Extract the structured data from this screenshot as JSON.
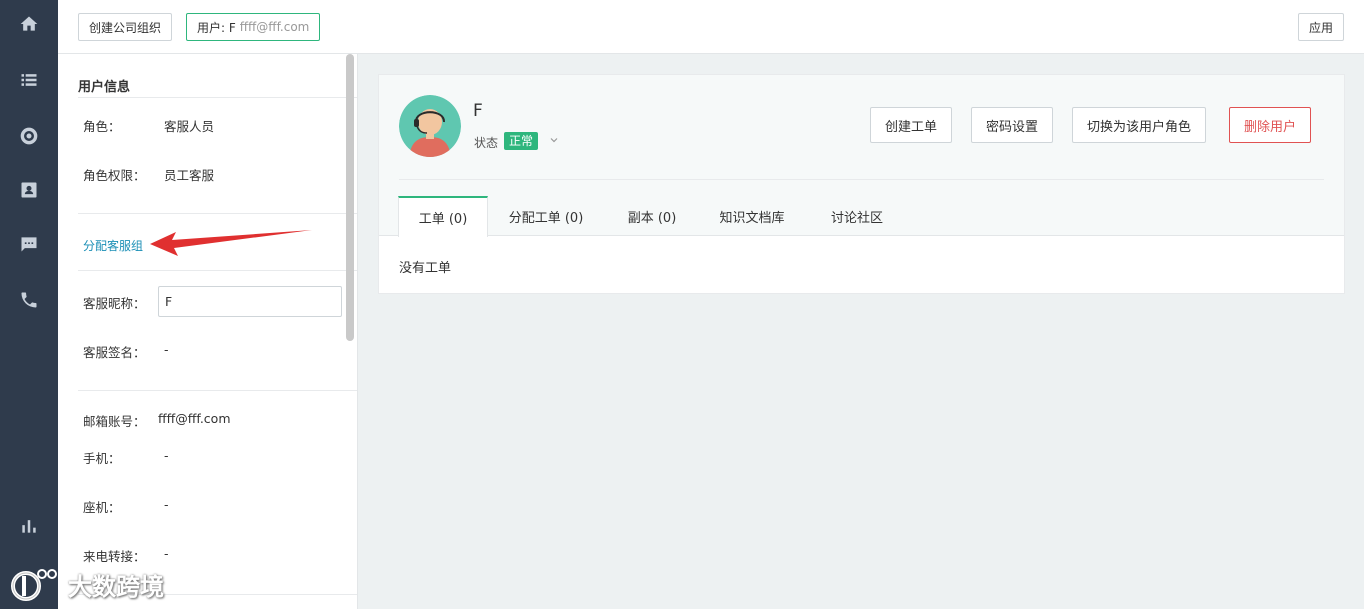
{
  "nav": {
    "icons": [
      "home-icon",
      "list-icon",
      "lifebuoy-icon",
      "contact-card-icon",
      "chat-icon",
      "phone-icon",
      "chart-icon"
    ]
  },
  "toolbar": {
    "create_org_label": "创建公司组织",
    "user_tag_label": "用户: F",
    "user_tag_email": "ffff@fff.com",
    "apply_label": "应用"
  },
  "user_info": {
    "title": "用户信息",
    "role_label": "角色：",
    "role_value": "客服人员",
    "permission_label": "角色权限：",
    "permission_value": "员工客服",
    "assign_group_link": "分配客服组",
    "nickname_label": "客服昵称：",
    "nickname_value": "F",
    "signature_label": "客服签名：",
    "signature_value": "-",
    "email_label": "邮箱账号：",
    "email_value": "ffff@fff.com",
    "mobile_label": "手机：",
    "mobile_value": "-",
    "landline_label": "座机：",
    "landline_value": "-",
    "forward_label": "来电转接：",
    "forward_value": "-"
  },
  "profile": {
    "name": "F",
    "status_label": "状态",
    "status_value": "正常",
    "status_color": "#2eb67d"
  },
  "actions": {
    "create_ticket": "创建工单",
    "password_settings": "密码设置",
    "switch_role": "切换为该用户角色",
    "delete_user": "删除用户"
  },
  "tabs": {
    "tickets": "工单 (0)",
    "assigned": "分配工单 (0)",
    "cc": "副本 (0)",
    "knowledge": "知识文档库",
    "community": "讨论社区"
  },
  "tickets": {
    "empty_text": "没有工单"
  },
  "watermark": {
    "brand": "大数跨境"
  },
  "colors": {
    "accent": "#2eb67d",
    "danger": "#e05252",
    "link": "#1b8fb6",
    "rail": "#2f3b4c"
  }
}
